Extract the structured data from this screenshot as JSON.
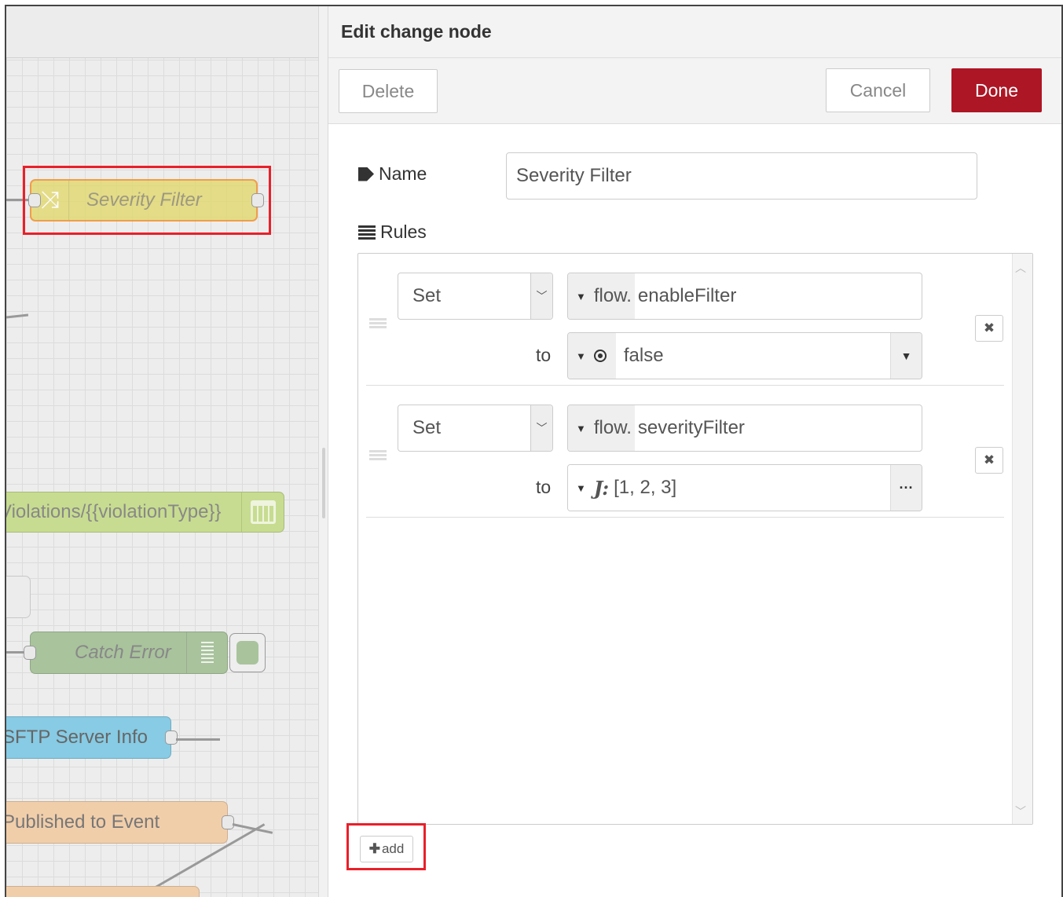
{
  "canvas": {
    "nodes": {
      "severity_filter": "Severity Filter",
      "violations": "Violations/{{violationType}}",
      "catch_error": "Catch Error",
      "sftp": "SFTP Server Info",
      "published": "Published to Event"
    }
  },
  "tray": {
    "title": "Edit change node",
    "toolbar": {
      "delete_label": "Delete",
      "cancel_label": "Cancel",
      "done_label": "Done"
    },
    "name_label": "Name",
    "name_value": "Severity Filter",
    "rules_label": "Rules",
    "rules": [
      {
        "action": "Set",
        "target_type": "flow.",
        "target_value": "enableFilter",
        "to_label": "to",
        "value_type_icon": "boolean-icon",
        "value": "false"
      },
      {
        "action": "Set",
        "target_type": "flow.",
        "target_value": "severityFilter",
        "to_label": "to",
        "value_type_icon": "json-icon",
        "value": "[1, 2, 3]"
      }
    ],
    "add_label": "add"
  },
  "colors": {
    "done": "#ad1625",
    "highlight": "#e8202a",
    "change_node": "#e2d96e"
  }
}
